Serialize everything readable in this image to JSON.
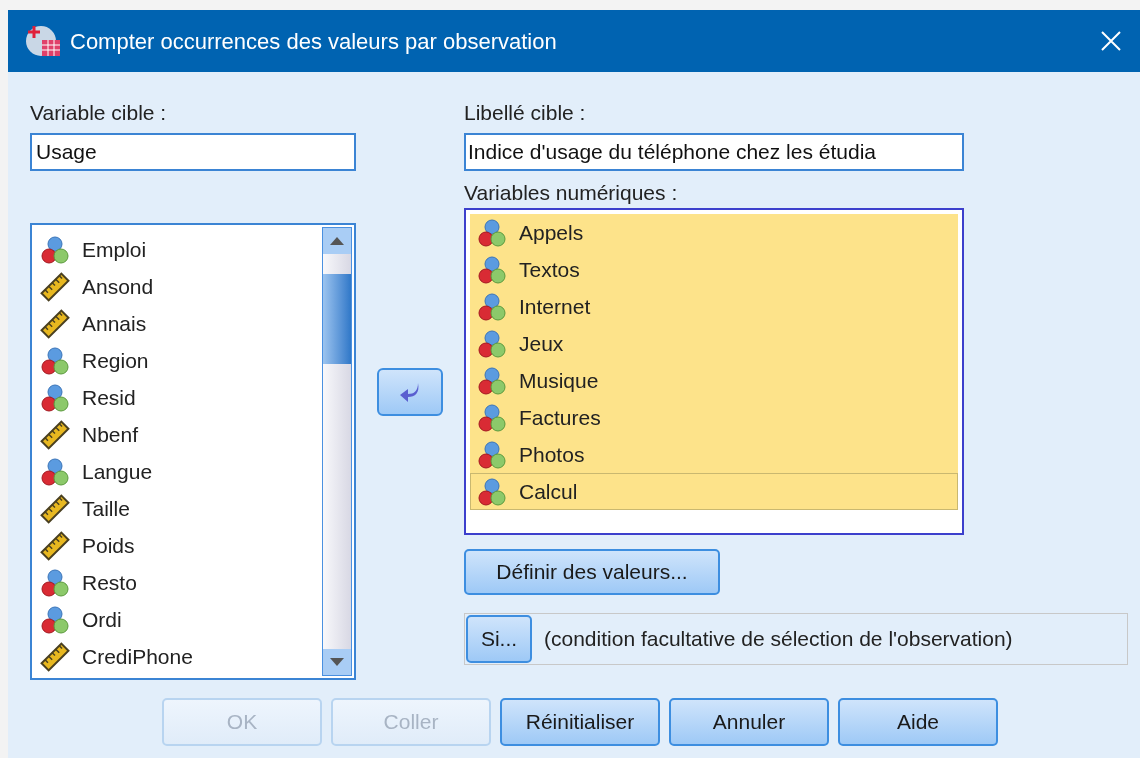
{
  "window": {
    "title": "Compter occurrences des valeurs par observation"
  },
  "target_variable": {
    "label": "Variable cible :",
    "value": "Usage"
  },
  "target_label": {
    "label": "Libellé cible :",
    "value": "Indice d'usage du téléphone chez les étudia"
  },
  "source_list": {
    "items": [
      {
        "name": "Emploi",
        "kind": "nominal"
      },
      {
        "name": "Ansond",
        "kind": "scale"
      },
      {
        "name": "Annais",
        "kind": "scale"
      },
      {
        "name": "Region",
        "kind": "nominal"
      },
      {
        "name": "Resid",
        "kind": "nominal"
      },
      {
        "name": "Nbenf",
        "kind": "scale"
      },
      {
        "name": "Langue",
        "kind": "nominal"
      },
      {
        "name": "Taille",
        "kind": "scale"
      },
      {
        "name": "Poids",
        "kind": "scale"
      },
      {
        "name": "Resto",
        "kind": "nominal"
      },
      {
        "name": "Ordi",
        "kind": "nominal"
      },
      {
        "name": "CrediPhone",
        "kind": "scale"
      }
    ]
  },
  "numeric_variables": {
    "label": "Variables numériques :",
    "items": [
      {
        "name": "Appels",
        "kind": "nominal",
        "selected": true,
        "focused": false
      },
      {
        "name": "Textos",
        "kind": "nominal",
        "selected": true,
        "focused": false
      },
      {
        "name": "Internet",
        "kind": "nominal",
        "selected": true,
        "focused": false
      },
      {
        "name": "Jeux",
        "kind": "nominal",
        "selected": true,
        "focused": false
      },
      {
        "name": "Musique",
        "kind": "nominal",
        "selected": true,
        "focused": false
      },
      {
        "name": "Factures",
        "kind": "nominal",
        "selected": true,
        "focused": false
      },
      {
        "name": "Photos",
        "kind": "nominal",
        "selected": true,
        "focused": false
      },
      {
        "name": "Calcul",
        "kind": "nominal",
        "selected": true,
        "focused": true
      }
    ]
  },
  "define_button": "Définir des valeurs...",
  "condition": {
    "button": "Si...",
    "text": "(condition facultative de sélection de l'observation)"
  },
  "buttons": [
    {
      "label": "OK",
      "disabled": true
    },
    {
      "label": "Coller",
      "disabled": true
    },
    {
      "label": "Réinitialiser",
      "disabled": false
    },
    {
      "label": "Annuler",
      "disabled": false
    },
    {
      "label": "Aide",
      "disabled": false
    }
  ]
}
